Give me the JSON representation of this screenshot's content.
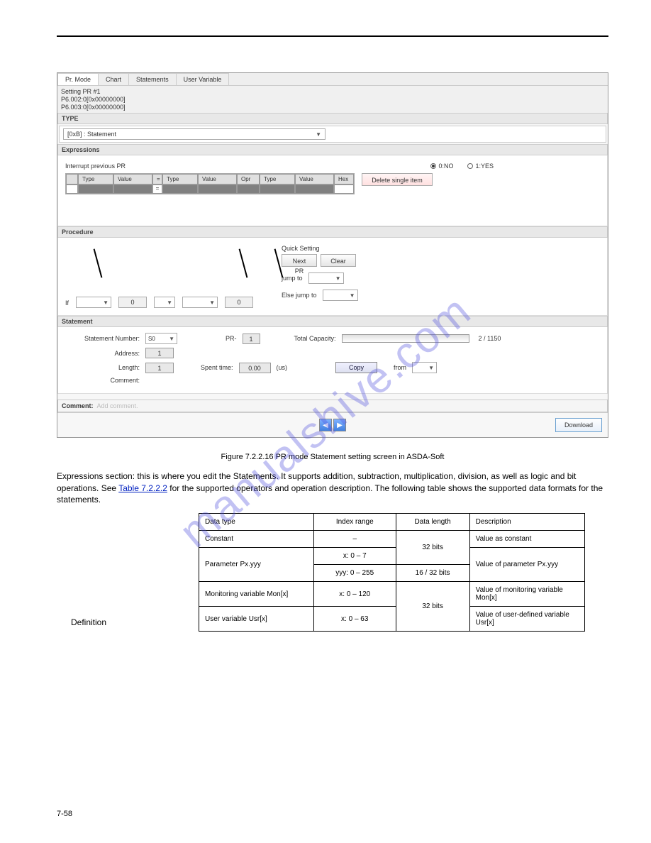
{
  "tabs": [
    "Pr. Mode",
    "Chart",
    "Statements",
    "User Variable"
  ],
  "setting": {
    "line1": "Setting PR #1",
    "line2": "P6.002:0[0x00000000]",
    "line3": "P6.003:0[0x00000000]"
  },
  "type": {
    "header": "TYPE",
    "option": "[0xB] : Statement"
  },
  "expressions": {
    "header": "Expressions",
    "interrupt_label": "Interrupt previous PR",
    "radio0": "0:NO",
    "radio1": "1:YES",
    "cols": [
      "",
      "Type",
      "Value",
      "=",
      "Type",
      "Value",
      "Opr",
      "Type",
      "Value",
      "Hex"
    ],
    "delete_btn": "Delete single item"
  },
  "procedure": {
    "header": "Procedure",
    "if_label": "If",
    "zero": "0",
    "quick_label": "Quick Setting",
    "next_btn": "Next PR",
    "clear_btn": "Clear",
    "jump_label": "jump to",
    "else_label": "Else jump to"
  },
  "statement": {
    "header": "Statement",
    "num_label": "Statement Number:",
    "num_val": "S0",
    "pr_label": "PR-",
    "pr_val": "1",
    "capacity_label": "Total Capacity:",
    "capacity_val": "2 / 1150",
    "addr_label": "Address:",
    "addr_val": "1",
    "len_label": "Length:",
    "len_val": "1",
    "spent_label": "Spent time:",
    "spent_val": "0.00",
    "spent_unit": "(us)",
    "copy_btn": "Copy",
    "from_label": "from",
    "comment_label": "Comment:"
  },
  "comment_bar": {
    "label": "Comment:",
    "placeholder": "Add comment."
  },
  "download_btn": "Download",
  "body": {
    "caption": "Figure 7.2.2.16 PR mode Statement setting screen in ASDA-Soft",
    "p1": "Expressions section: this is where you edit the Statements. It supports addition, subtraction, multiplication, division, as well as logic and bit operations. See ",
    "p1_link": "Table 7.2.2.2",
    "p1_cont": " for the supported operators and operation description. The following table shows the supported data formats for the statements.",
    "side_label": "Definition",
    "table_h": [
      "Data type",
      "Index range",
      "Data length",
      "Description"
    ],
    "table_rows": [
      [
        "Constant",
        "–",
        "32 bits",
        "Value as constant"
      ],
      [
        "Parameter Px.yyy",
        "x: 0 – 7\nyyy: 0 – 255",
        "16 / 32 bits",
        "Value of parameter Px.yyy"
      ],
      [
        "Monitoring variable Mon[x]",
        "x: 0 – 120",
        "32 bits",
        "Value of monitoring variable Mon[x]"
      ],
      [
        "User variable Usr[x]",
        "x: 0 – 63",
        "32 bits",
        "Value of user-defined variable Usr[x]"
      ]
    ]
  },
  "watermark": "manualshive.com",
  "footer_page": "7-58"
}
